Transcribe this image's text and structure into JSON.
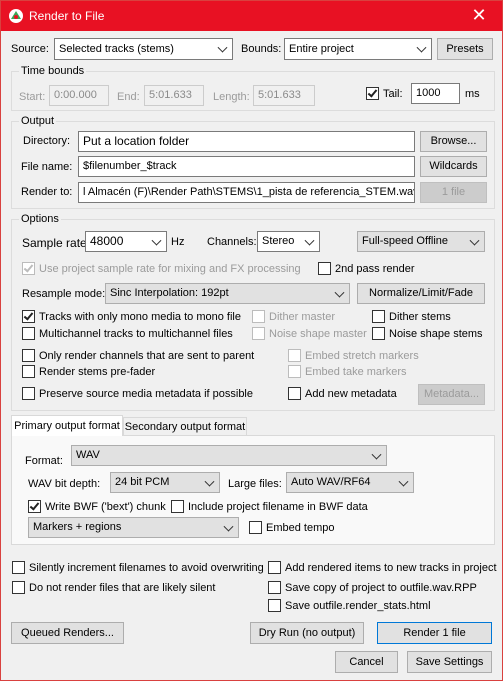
{
  "window": {
    "title": "Render to File",
    "close_glyph": "✕"
  },
  "top": {
    "source_label": "Source:",
    "source_value": "Selected tracks (stems)",
    "bounds_label": "Bounds:",
    "bounds_value": "Entire project",
    "presets": "Presets"
  },
  "time_bounds": {
    "title": "Time bounds",
    "start_label": "Start:",
    "start_value": "0:00.000",
    "end_label": "End:",
    "end_value": "5:01.633",
    "length_label": "Length:",
    "length_value": "5:01.633",
    "tail_label": "Tail:",
    "tail_checked": true,
    "tail_value": "1000",
    "tail_unit": "ms"
  },
  "output": {
    "title": "Output",
    "directory_label": "Directory:",
    "directory_value": "Put a location folder",
    "browse": "Browse...",
    "filename_label": "File name:",
    "filename_value": "$filenumber_$track",
    "wildcards": "Wildcards",
    "renderto_label": "Render to:",
    "renderto_value": "l Almacén (F)\\Render Path\\STEMS\\1_pista de referencia_STEM.wav",
    "file_count": "1 file"
  },
  "options": {
    "title": "Options",
    "sample_rate_label": "Sample rate:",
    "sample_rate_value": "48000",
    "sample_rate_unit": "Hz",
    "channels_label": "Channels:",
    "channels_value": "Stereo",
    "speed_value": "Full-speed Offline",
    "use_project_rate": "Use project sample rate for mixing and FX processing",
    "second_pass": "2nd pass render",
    "resample_label": "Resample mode:",
    "resample_value": "Sinc Interpolation: 192pt",
    "normalize": "Normalize/Limit/Fade",
    "mono_to_mono": "Tracks with only mono media to mono file",
    "dither_master": "Dither master",
    "dither_stems": "Dither stems",
    "multichannel": "Multichannel tracks to multichannel files",
    "noise_master": "Noise shape master",
    "noise_stems": "Noise shape stems",
    "only_parent": "Only render channels that are sent to parent",
    "embed_stretch": "Embed stretch markers",
    "prefader": "Render stems pre-fader",
    "embed_take": "Embed take markers",
    "preserve_meta": "Preserve source media metadata if possible",
    "add_meta": "Add new metadata",
    "metadata_btn": "Metadata..."
  },
  "tabs": {
    "primary": "Primary output format",
    "secondary": "Secondary output format"
  },
  "format": {
    "format_label": "Format:",
    "format_value": "WAV",
    "bitdepth_label": "WAV bit depth:",
    "bitdepth_value": "24 bit PCM",
    "largefiles_label": "Large files:",
    "largefiles_value": "Auto WAV/RF64",
    "bwf_chunk": "Write BWF ('bext') chunk",
    "include_filename": "Include project filename in BWF data",
    "markers_value": "Markers + regions",
    "embed_tempo": "Embed tempo"
  },
  "bottom": {
    "silent_increment": "Silently increment filenames to avoid overwriting",
    "add_rendered": "Add rendered items to new tracks in project",
    "no_silent": "Do not render files that are likely silent",
    "save_copy": "Save copy of project to outfile.wav.RPP",
    "save_stats": "Save outfile.render_stats.html",
    "queued": "Queued Renders...",
    "dry_run": "Dry Run (no output)",
    "render": "Render 1 file",
    "cancel": "Cancel",
    "save_settings": "Save Settings"
  }
}
